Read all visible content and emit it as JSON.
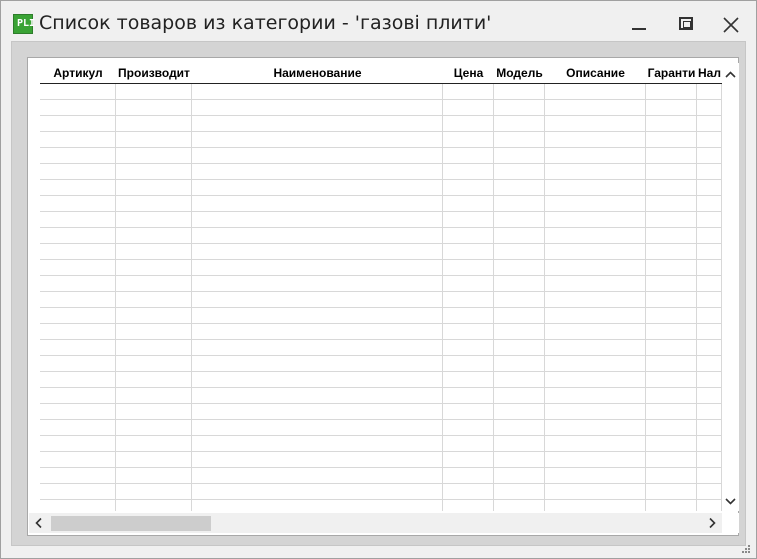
{
  "window": {
    "title": "Список товаров из категории - 'газові плити'",
    "icon_text": "PLI",
    "icon_color": "#3aa335"
  },
  "table": {
    "columns": [
      {
        "key": "article",
        "label": "Артикул"
      },
      {
        "key": "manufacturer",
        "label": "Производит"
      },
      {
        "key": "name",
        "label": "Наименование"
      },
      {
        "key": "price",
        "label": "Цена"
      },
      {
        "key": "model",
        "label": "Модель"
      },
      {
        "key": "description",
        "label": "Описание"
      },
      {
        "key": "warranty",
        "label": "Гаранти"
      },
      {
        "key": "stock",
        "label": "Нал"
      }
    ],
    "rows": []
  },
  "colors": {
    "background": "#f0f0f0",
    "panel": "#ffffff",
    "gridline": "#d8d8d8",
    "scroll_thumb": "#cdcdcd"
  }
}
